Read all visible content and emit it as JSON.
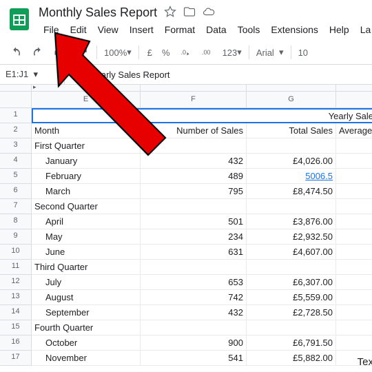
{
  "doc": {
    "title": "Monthly Sales Report"
  },
  "menu": {
    "file": "File",
    "edit": "Edit",
    "view": "View",
    "insert": "Insert",
    "format": "Format",
    "data": "Data",
    "tools": "Tools",
    "extensions": "Extensions",
    "help": "Help",
    "last": "La"
  },
  "toolbar": {
    "zoom": "100%",
    "currency": "£",
    "percent": "%",
    "num_format": "123",
    "font": "Arial",
    "size": "10"
  },
  "nameBox": "E1:J1",
  "formula": "Yearly Sales Report",
  "colHeaders": [
    "E",
    "F",
    "G",
    ""
  ],
  "rowHeaders": [
    "1",
    "2",
    "3",
    "4",
    "5",
    "6",
    "7",
    "8",
    "9",
    "10",
    "11",
    "12",
    "13",
    "14",
    "15",
    "16",
    "17"
  ],
  "titleCell": "Yearly Sale",
  "rows": [
    {
      "e": "Month",
      "f": "Number of Sales",
      "g": "Total Sales",
      "h": "Average"
    },
    {
      "e": "First Quarter",
      "f": "",
      "g": "",
      "h": ""
    },
    {
      "e": "January",
      "indent": true,
      "f": "432",
      "g": "£4,026.00",
      "h": ""
    },
    {
      "e": "February",
      "indent": true,
      "f": "489",
      "g": "5006.5",
      "link": true,
      "h": ""
    },
    {
      "e": "March",
      "indent": true,
      "f": "795",
      "g": "£8,474.50",
      "h": ""
    },
    {
      "e": "Second Quarter",
      "f": "",
      "g": "",
      "h": ""
    },
    {
      "e": "April",
      "indent": true,
      "f": "501",
      "g": "£3,876.00",
      "h": ""
    },
    {
      "e": "May",
      "indent": true,
      "f": "234",
      "g": "£2,932.50",
      "h": ""
    },
    {
      "e": "June",
      "indent": true,
      "f": "631",
      "g": "£4,607.00",
      "h": ""
    },
    {
      "e": "Third Quarter",
      "f": "",
      "g": "",
      "h": ""
    },
    {
      "e": "July",
      "indent": true,
      "f": "653",
      "g": "£6,307.00",
      "h": ""
    },
    {
      "e": "August",
      "indent": true,
      "f": "742",
      "g": "£5,559.00",
      "h": ""
    },
    {
      "e": "September",
      "indent": true,
      "f": "432",
      "g": "£2,728.50",
      "h": ""
    },
    {
      "e": "Fourth Quarter",
      "f": "",
      "g": "",
      "h": ""
    },
    {
      "e": "October",
      "indent": true,
      "f": "900",
      "g": "£6,791.50",
      "h": ""
    },
    {
      "e": "November",
      "indent": true,
      "f": "541",
      "g": "£5,882.00",
      "h": ""
    }
  ],
  "colWidths": {
    "e": 158,
    "f": 154,
    "g": 130,
    "h": 60
  },
  "floatText": "Tex"
}
